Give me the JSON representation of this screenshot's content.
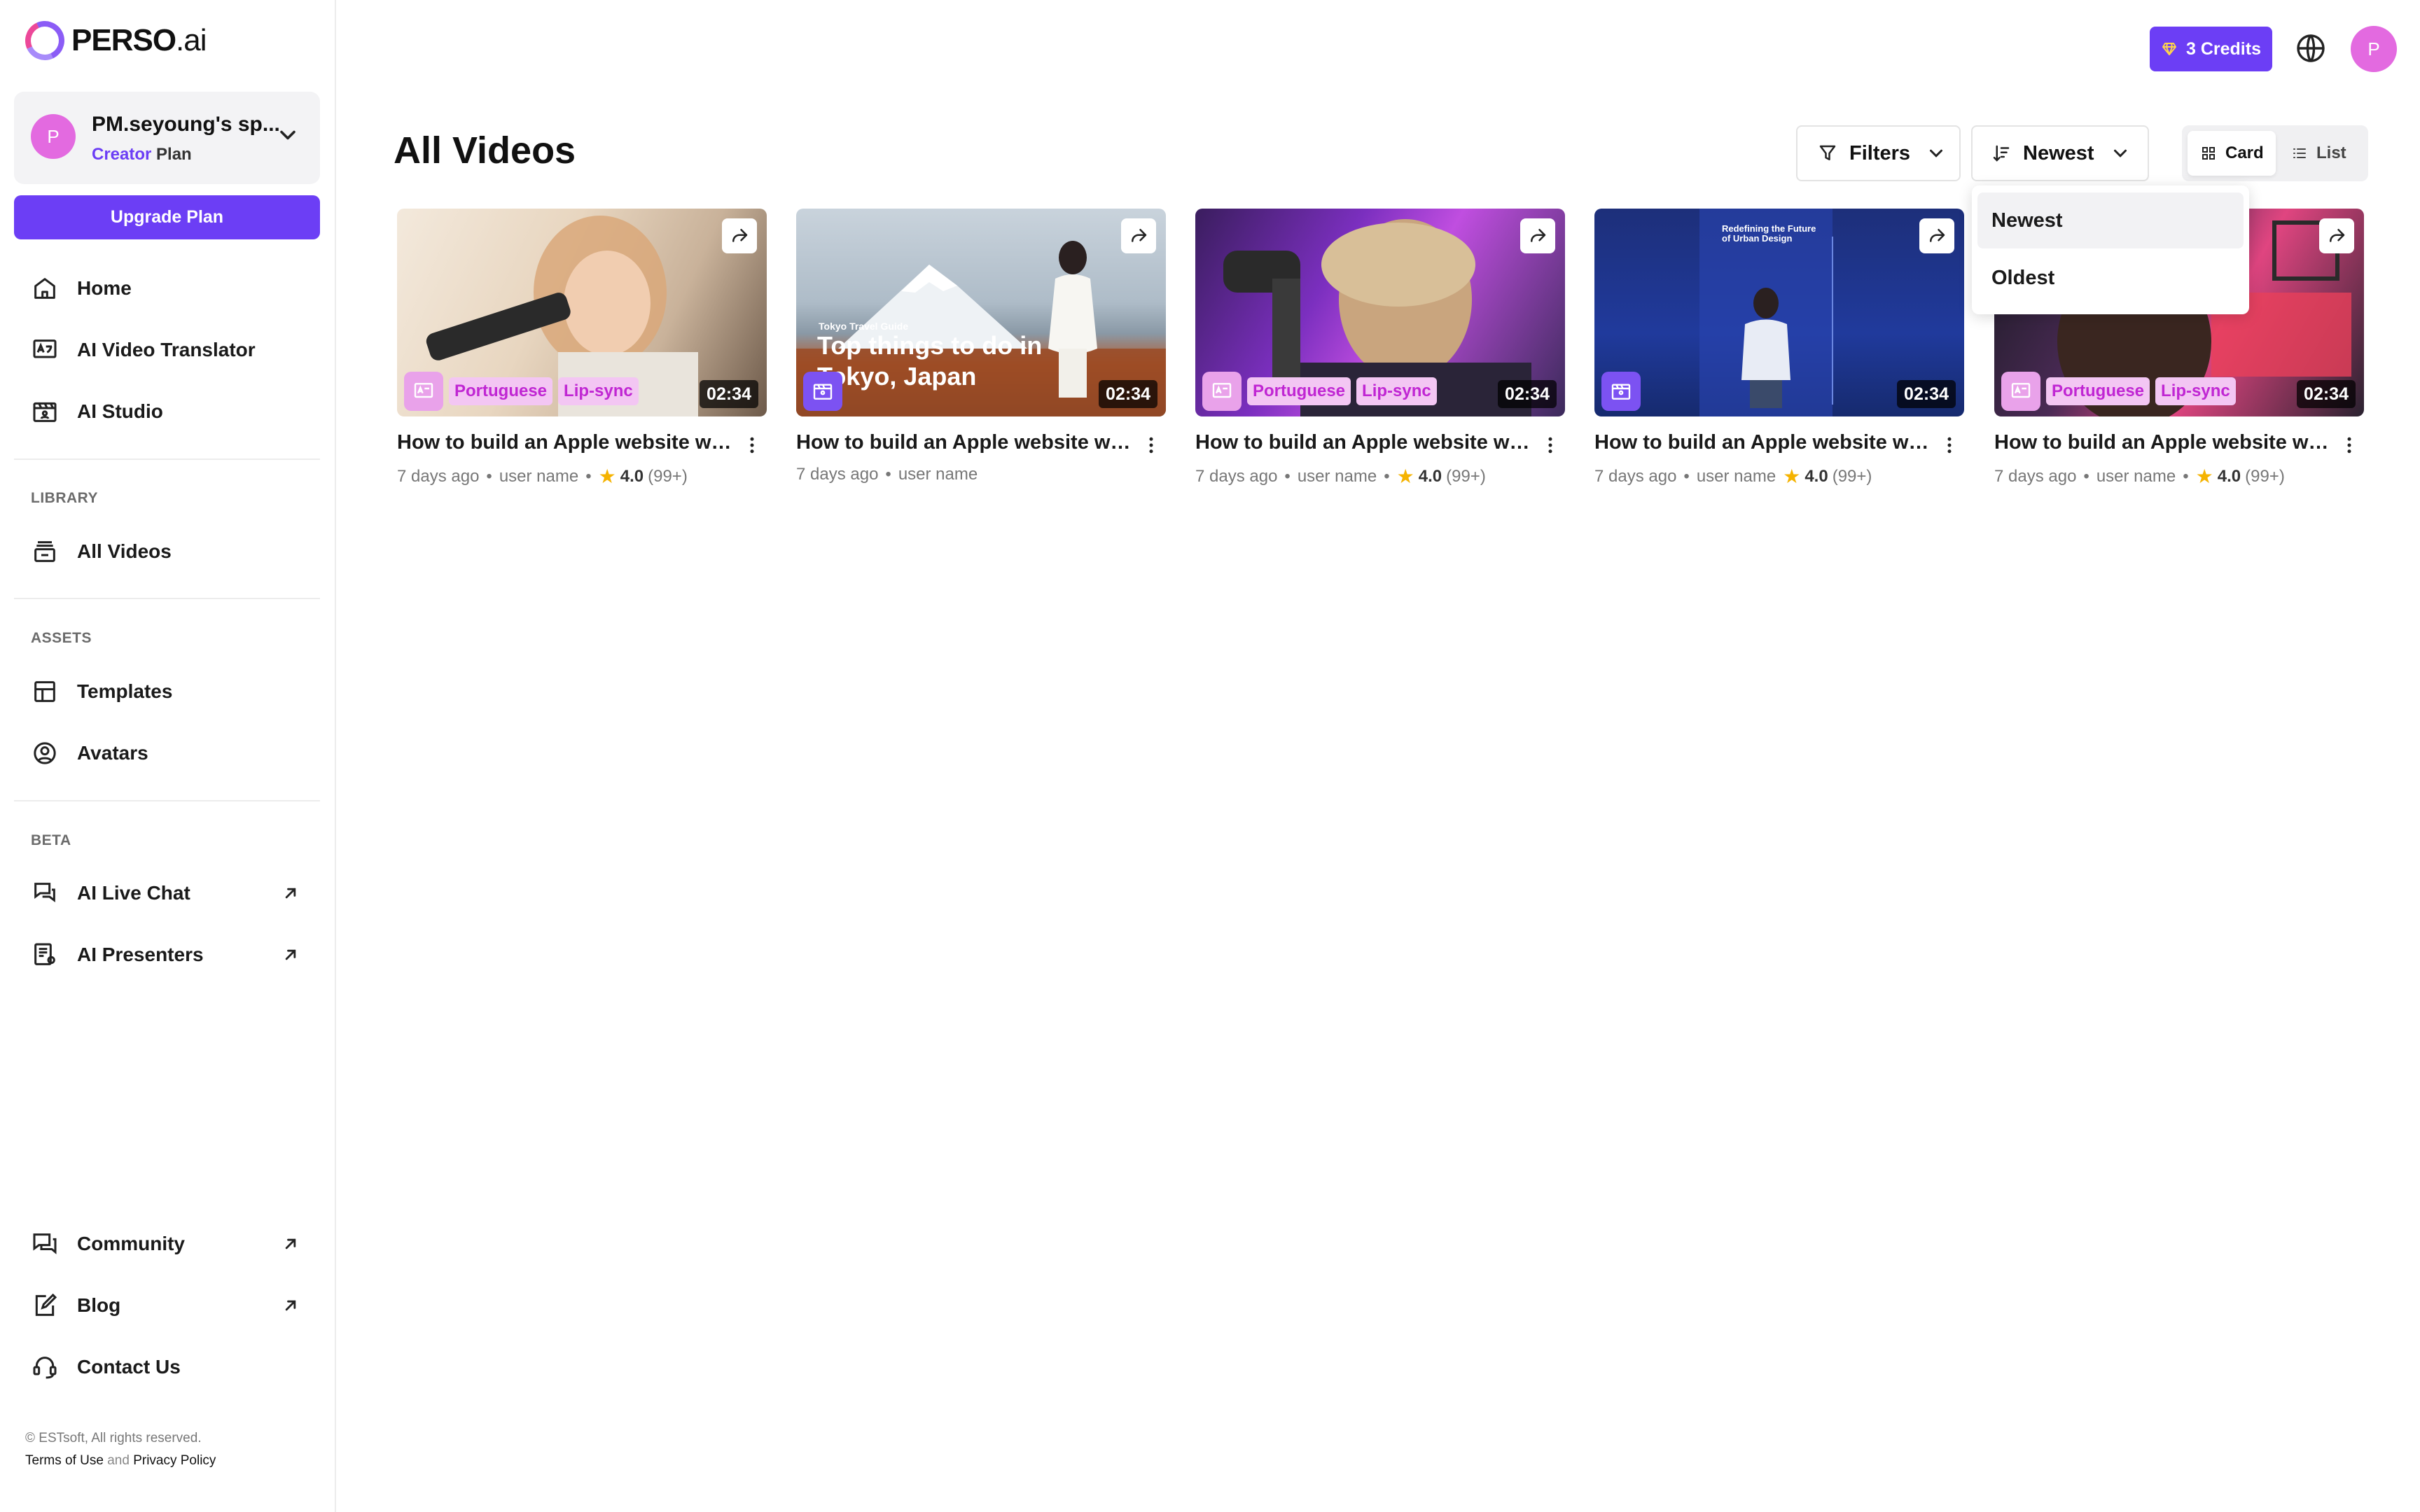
{
  "brand": {
    "name_bold": "PERSO",
    "name_light": ".ai"
  },
  "workspace": {
    "avatar_letter": "P",
    "name": "PM.seyoung's sp...",
    "plan_accent": "Creator",
    "plan_suffix": " Plan"
  },
  "sidebar": {
    "upgrade_label": "Upgrade Plan",
    "main_items": [
      {
        "label": "Home",
        "icon": "home-icon"
      },
      {
        "label": "AI Video Translator",
        "icon": "translate-icon"
      },
      {
        "label": "AI Studio",
        "icon": "studio-icon"
      }
    ],
    "library_title": "LIBRARY",
    "library_items": [
      {
        "label": "All Videos",
        "icon": "video-library-icon"
      }
    ],
    "assets_title": "ASSETS",
    "assets_items": [
      {
        "label": "Templates",
        "icon": "template-icon"
      },
      {
        "label": "Avatars",
        "icon": "avatar-icon"
      }
    ],
    "beta_title": "BETA",
    "beta_items": [
      {
        "label": "AI Live Chat",
        "icon": "chat-icon"
      },
      {
        "label": "AI Presenters",
        "icon": "presenter-icon"
      }
    ],
    "bottom_items": [
      {
        "label": "Community",
        "icon": "community-icon"
      },
      {
        "label": "Blog",
        "icon": "blog-icon"
      },
      {
        "label": "Contact Us",
        "icon": "headset-icon"
      }
    ],
    "footer": {
      "copyright": "© ESTsoft, All rights reserved.",
      "terms": "Terms of Use",
      "and": "and",
      "privacy": "Privacy Policy"
    }
  },
  "topbar": {
    "credits_label": "3 Credits",
    "avatar_letter": "P"
  },
  "main": {
    "title": "All Videos",
    "filters_label": "Filters",
    "sort_label": "Newest",
    "view": {
      "card_label": "Card",
      "list_label": "List",
      "active": "Card"
    },
    "sort_options": [
      "Newest",
      "Oldest"
    ],
    "sort_selected": "Newest"
  },
  "videos": [
    {
      "title": "How to build an Apple website with...",
      "type": "translator",
      "tags": [
        "Portuguese",
        "Lip-sync"
      ],
      "duration": "02:34",
      "age": "7 days ago",
      "user": "user name",
      "rating": "4.0",
      "rating_count": "(99+)"
    },
    {
      "title": "How to build an Apple website with...",
      "type": "studio",
      "tags": [],
      "duration": "02:34",
      "age": "7 days ago",
      "user": "user name",
      "overlay_small": "Tokyo Travel Guide",
      "overlay_big": "Top things to do in Tokyo, Japan"
    },
    {
      "title": "How to build an Apple website with...",
      "type": "translator",
      "tags": [
        "Portuguese",
        "Lip-sync"
      ],
      "duration": "02:34",
      "age": "7 days ago",
      "user": "user name",
      "rating": "4.0",
      "rating_count": "(99+)"
    },
    {
      "title": "How to build an Apple website with...",
      "type": "studio",
      "tags": [],
      "duration": "02:34",
      "age": "7 days ago",
      "user": "user name",
      "rating": "4.0",
      "rating_count": "(99+)",
      "overlay_big": "Redefining the Future of Urban Design"
    },
    {
      "title": "How to build an Apple website with...",
      "type": "translator",
      "tags": [
        "Portuguese",
        "Lip-sync"
      ],
      "duration": "02:34",
      "age": "7 days ago",
      "user": "user name",
      "rating": "4.0",
      "rating_count": "(99+)"
    }
  ],
  "colors": {
    "accent": "#6c3ef5",
    "avatar": "#e36ae0",
    "tag_bg": "#f3c6f3",
    "tag_text": "#c026d3",
    "star": "#f5b301"
  }
}
